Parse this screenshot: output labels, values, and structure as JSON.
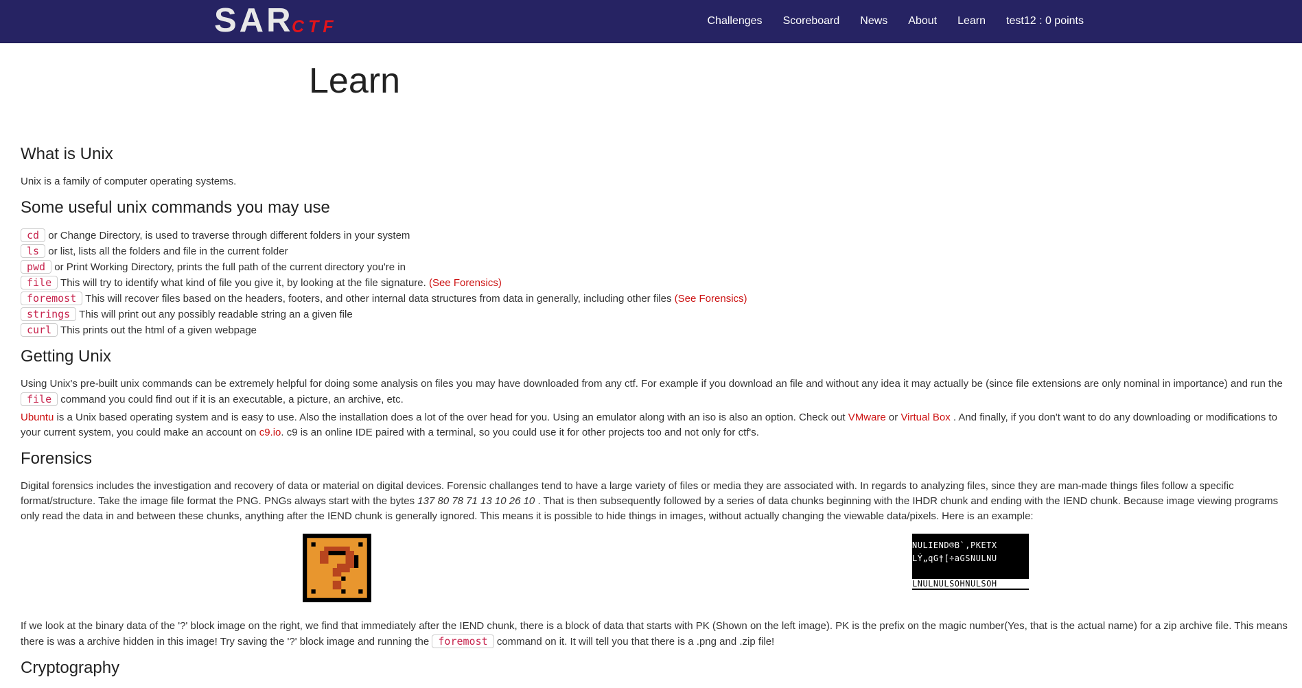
{
  "brand": {
    "name": "SAR",
    "sub": "CTF"
  },
  "nav": [
    "Challenges",
    "Scoreboard",
    "News",
    "About",
    "Learn",
    "test12 : 0 points"
  ],
  "title": "Learn",
  "unix": {
    "heading": "What is Unix",
    "text": "Unix is a family of computer operating systems."
  },
  "commands": {
    "heading": "Some useful unix commands you may use",
    "items": [
      {
        "cmd": "cd",
        "desc": "or Change Directory, is used to traverse through different folders in your system"
      },
      {
        "cmd": "ls",
        "desc": "or list, lists all the folders and file in the current folder"
      },
      {
        "cmd": "pwd",
        "desc": "or Print Working Directory, prints the full path of the current directory you're in"
      },
      {
        "cmd": "file",
        "desc": "This will try to identify what kind of file you give it, by looking at the file signature.",
        "link": "(See Forensics)"
      },
      {
        "cmd": "foremost",
        "desc": "This will recover files based on the headers, footers, and other internal data structures from data in generally, including other files",
        "link": "(See Forensics)"
      },
      {
        "cmd": "strings",
        "desc": "This will print out any possibly readable string an a given file"
      },
      {
        "cmd": "curl",
        "desc": "This prints out the html of a given webpage"
      }
    ]
  },
  "getting": {
    "heading": "Getting Unix",
    "p1a": "Using Unix's pre-built unix commands can be extremely helpful for doing some analysis on files you may have downloaded from any ctf. For example if you download an file and without any idea it may actually be (since file extensions are only nominal in importance) and run the",
    "p1cmd": "file",
    "p1b": "command you could find out if it is an executable, a picture, an archive, etc.",
    "ubuntu": "Ubuntu",
    "p2a": "is a Unix based operating system and is easy to use. Also the installation does a lot of the over head for you. Using an emulator along with an iso is also an option. Check out",
    "vmware": "VMware",
    "or": "or",
    "vbox": "Virtual Box",
    "p2b": ". And finally, if you don't want to do any downloading or modifications to your current system, you could make an account on",
    "c9": "c9.io",
    "p2c": ". c9 is an online IDE paired with a terminal, so you could use it for other projects too and not only for ctf's."
  },
  "forensics": {
    "heading": "Forensics",
    "p1a": "Digital forensics includes the investigation and recovery of data or material on digital devices. Forensic challanges tend to have a large variety of files or media they are associated with. In regards to analyzing files, since they are man-made things files follow a specific format/structure. Take the image file format the PNG. PNGs always start with the bytes",
    "bytes": "137 80 78 71 13 10 26 10",
    "p1b": ". That is then subsequently followed by a series of data chunks beginning with the IHDR chunk and ending with the IEND chunk. Because image viewing programs only read the data in and between these chunks, anything after the IEND chunk is generally ignored. This means it is possible to hide things in images, without actually changing the viewable data/pixels. Here is an example:",
    "bin_rows": [
      "NULIEND®B`,PKETX",
      "LÝ„qG†[÷aGSNULNU",
      "LNULNULSOHNULSOH"
    ],
    "p2a": "If we look at the binary data of the '?' block image on the right, we find that immediately after the IEND chunk, there is a block of data that starts with PK (Shown on the left image). PK is the prefix on the magic number(Yes, that is the actual name) for a zip archive file. This means there is was a archive hidden in this image! Try saving the '?' block image and running the",
    "p2cmd": "foremost",
    "p2b": "command on it. It will tell you that there is a .png and .zip file!"
  },
  "crypto": {
    "heading": "Cryptography"
  },
  "colors": {
    "navbar": "#262363",
    "accent": "#e1141b",
    "code": "#c7254e"
  }
}
